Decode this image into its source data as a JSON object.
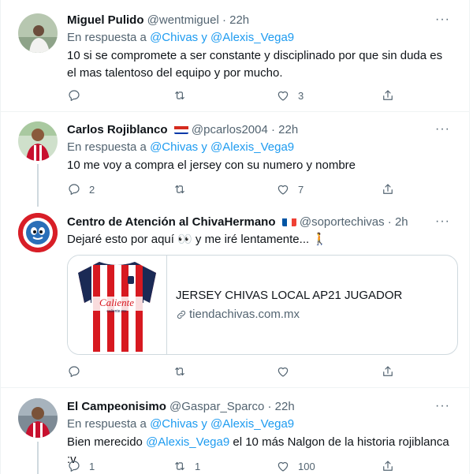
{
  "tweets": [
    {
      "name": "Miguel Pulido",
      "handle": "@wentmiguel",
      "sep": "·",
      "time": "22h",
      "reply_prefix": "En respuesta a",
      "reply_user1": "@Chivas",
      "reply_and": "y",
      "reply_user2": "@Alexis_Vega9",
      "text": "10 si se compromete a ser constante y disciplinado por que sin duda es el mas talentoso del equipo y por mucho.",
      "replies": "",
      "retweets": "",
      "likes": "3"
    },
    {
      "name": "Carlos Rojiblanco",
      "handle": "@pcarlos2004",
      "sep": "·",
      "time": "22h",
      "reply_prefix": "En respuesta a",
      "reply_user1": "@Chivas",
      "reply_and": "y",
      "reply_user2": "@Alexis_Vega9",
      "text": "10 me voy a compra el jersey con su numero y nombre",
      "replies": "2",
      "retweets": "",
      "likes": "7"
    },
    {
      "name": "Centro de Atención al ChivaHermano",
      "handle": "@soportechivas",
      "sep": "·",
      "time": "2h",
      "text": "Dejaré esto por aquí 👀 y me iré lentamente... 🚶",
      "card_title": "JERSEY CHIVAS LOCAL AP21 JUGADOR",
      "card_domain": "tiendachivas.com.mx",
      "card_brand": "Caliente",
      "card_brand_sub": "caliente.mx",
      "replies": "",
      "retweets": "",
      "likes": ""
    },
    {
      "name": "El Campeonisimo",
      "handle": "@Gaspar_Sparco",
      "sep": "·",
      "time": "22h",
      "reply_prefix": "En respuesta a",
      "reply_user1": "@Chivas",
      "reply_and": "y",
      "reply_user2": "@Alexis_Vega9",
      "text_pre": "Bien merecido",
      "text_mention": "@Alexis_Vega9",
      "text_post": "el 10 más Nalgon de la historia rojiblanca :v",
      "replies": "1",
      "retweets": "1",
      "likes": "100"
    }
  ],
  "more_label": "···",
  "colors": {
    "link": "#1d9bf0",
    "muted": "#536471",
    "border": "#eff3f4"
  }
}
